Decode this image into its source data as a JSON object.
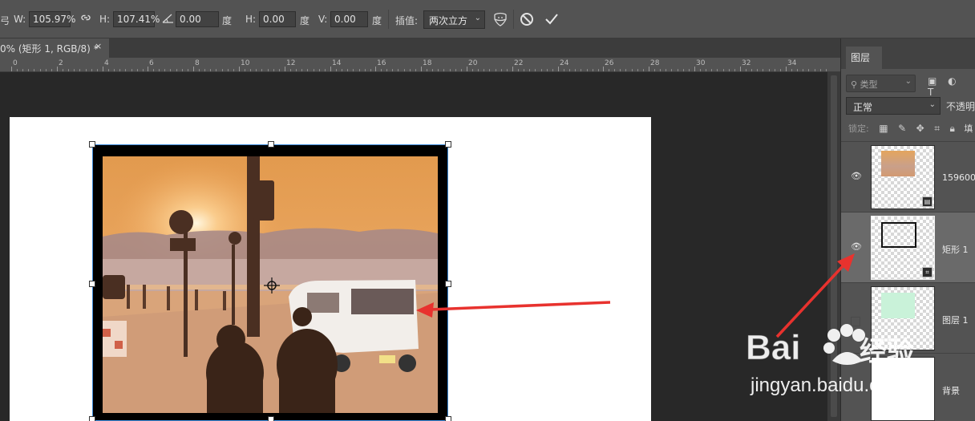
{
  "options_bar": {
    "w_label": "W:",
    "w_value": "105.97%",
    "h_label": "H:",
    "h_value": "107.41%",
    "angle_value": "0.00",
    "degree_unit": "度",
    "hskew_label": "H:",
    "hskew_value": "0.00",
    "vskew_label": "V:",
    "vskew_value": "0.00",
    "interp_label": "插值:",
    "interp_value": "两次立方",
    "left_fragment": "弓"
  },
  "document_tab": {
    "title": "0% (矩形 1, RGB/8) *",
    "close": "×"
  },
  "ruler": {
    "ticks": [
      "0",
      "2",
      "4",
      "6",
      "8",
      "10",
      "12",
      "14",
      "16",
      "18",
      "20",
      "22",
      "24",
      "26",
      "28",
      "30",
      "32",
      "34"
    ]
  },
  "layers_panel": {
    "tab_label": "图层",
    "filter_placeholder": "类型",
    "blend_mode": "正常",
    "opacity_label": "不透明",
    "lock_label": "锁定:",
    "fill_label": "填",
    "layers": [
      {
        "name": "159600...",
        "visible": true,
        "type": "smart-object"
      },
      {
        "name": "矩形 1",
        "visible": true,
        "type": "shape",
        "selected": true
      },
      {
        "name": "图层 1",
        "visible": false,
        "type": "pixel"
      },
      {
        "name": "背景",
        "visible": false,
        "type": "background"
      }
    ]
  },
  "watermark": {
    "brand": "Baidu经验",
    "url": "jingyan.baidu.com"
  },
  "colors": {
    "bbox": "#3d8bd9",
    "arrow": "#e8322e",
    "swatch": "#c9f2d9"
  }
}
